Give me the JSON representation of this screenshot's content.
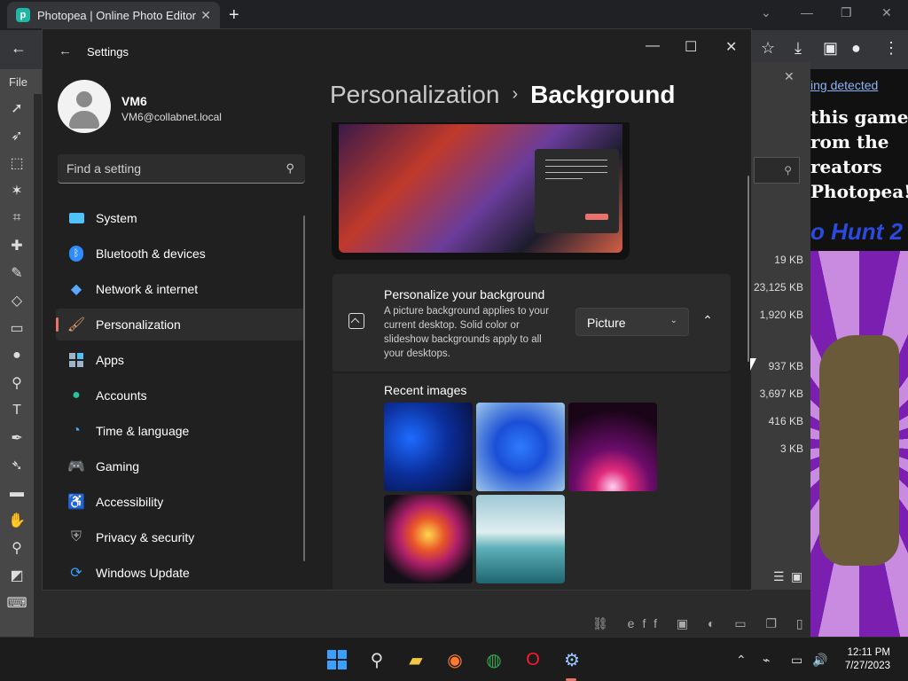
{
  "browser": {
    "tab_title": "Photopea | Online Photo Editor",
    "tab_close": "✕",
    "new_tab": "+"
  },
  "photopea": {
    "menu_file": "File",
    "file_sizes": [
      "19 KB",
      "23,125 KB",
      "1,920 KB",
      "937 KB",
      "3,697 KB",
      "416 KB",
      "3 KB"
    ],
    "ad": {
      "link": "ing detected",
      "lines": [
        "this game",
        "rom the",
        "reators",
        "Photopea!"
      ],
      "hunt": "o Hunt 2"
    }
  },
  "settings": {
    "window_title": "Settings",
    "profile": {
      "name": "VM6",
      "email": "VM6@collabnet.local"
    },
    "search_placeholder": "Find a setting",
    "nav": [
      {
        "label": "System",
        "icon": "system-icon",
        "color": "#4fc3f7"
      },
      {
        "label": "Bluetooth & devices",
        "icon": "bluetooth-icon",
        "color": "#2f8cff"
      },
      {
        "label": "Network & internet",
        "icon": "wifi-icon",
        "color": "#5aa9ff"
      },
      {
        "label": "Personalization",
        "icon": "brush-icon",
        "color": "#f0a070",
        "active": true
      },
      {
        "label": "Apps",
        "icon": "apps-icon",
        "color": "#9fb4c8"
      },
      {
        "label": "Accounts",
        "icon": "accounts-icon",
        "color": "#27c2a0"
      },
      {
        "label": "Time & language",
        "icon": "clock-globe-icon",
        "color": "#3ab0ff"
      },
      {
        "label": "Gaming",
        "icon": "gamepad-icon",
        "color": "#b0b0b0"
      },
      {
        "label": "Accessibility",
        "icon": "accessibility-icon",
        "color": "#3aa0ff"
      },
      {
        "label": "Privacy & security",
        "icon": "shield-icon",
        "color": "#9a9a9a"
      },
      {
        "label": "Windows Update",
        "icon": "update-icon",
        "color": "#3aa0ff"
      }
    ],
    "breadcrumb": {
      "parent": "Personalization",
      "separator": "›",
      "current": "Background"
    },
    "background_card": {
      "title": "Personalize your background",
      "description": "A picture background applies to your current desktop. Solid color or slideshow backgrounds apply to all your desktops.",
      "dropdown_value": "Picture"
    },
    "recent_images": {
      "title": "Recent images"
    }
  },
  "taskbar": {
    "time": "12:11 PM",
    "date": "7/27/2023"
  },
  "colors": {
    "accent": "#e8736a",
    "window_bg": "#202020",
    "card_bg": "#2b2b2b"
  }
}
